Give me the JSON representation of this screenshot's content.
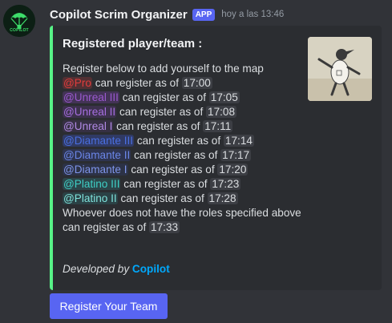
{
  "message": {
    "username": "Copilot Scrim Organizer",
    "badge": "APP",
    "timestamp": "hoy a las 13:46",
    "avatar_text": "COPILOT"
  },
  "embed": {
    "accent_color": "#57f287",
    "title": "Registered player/team :",
    "intro": "Register below to add yourself to the map",
    "rows": [
      {
        "role": "@Pro",
        "text": " can register as of ",
        "time": "17:00",
        "color": "#e13c3c",
        "bg": "rgba(225,60,60,0.22)"
      },
      {
        "role": "@Unreal III",
        "text": " can register as of ",
        "time": "17:05",
        "color": "#9b59d0",
        "bg": "rgba(140,70,200,0.25)"
      },
      {
        "role": "@Unreal II",
        "text": " can register as of ",
        "time": "17:08",
        "color": "#a66ee0",
        "bg": "rgba(140,70,200,0.18)"
      },
      {
        "role": "@Unreal I",
        "text": " can register as of ",
        "time": "17:11",
        "color": "#b189e6",
        "bg": "rgba(140,70,200,0.12)"
      },
      {
        "role": "@Diamante III",
        "text": " can register as of ",
        "time": "17:14",
        "color": "#4a6fe0",
        "bg": "rgba(60,90,220,0.3)"
      },
      {
        "role": "@Diamante II",
        "text": " can register as of ",
        "time": "17:17",
        "color": "#6b86e8",
        "bg": "rgba(60,90,220,0.18)"
      },
      {
        "role": "@Diamante I",
        "text": " can register as of ",
        "time": "17:20",
        "color": "#7f95ea",
        "bg": "rgba(60,90,220,0.12)"
      },
      {
        "role": "@Platino III",
        "text": " can register as of ",
        "time": "17:23",
        "color": "#3ecfc6",
        "bg": "rgba(50,190,190,0.18)"
      },
      {
        "role": "@Platino II",
        "text": " can register as of ",
        "time": "17:28",
        "color": "#7fe3dc",
        "bg": "rgba(50,190,190,0.14)"
      }
    ],
    "outro_1": "Whoever does not have the roles specified above",
    "outro_2": "can register as of ",
    "outro_time": "17:33",
    "footer_prefix": "Developed by ",
    "footer_link": "Copilot",
    "thumbnail_icon": "cartoon-figure-image"
  },
  "button": {
    "label": "Register Your Team",
    "color": "#5865f2"
  }
}
